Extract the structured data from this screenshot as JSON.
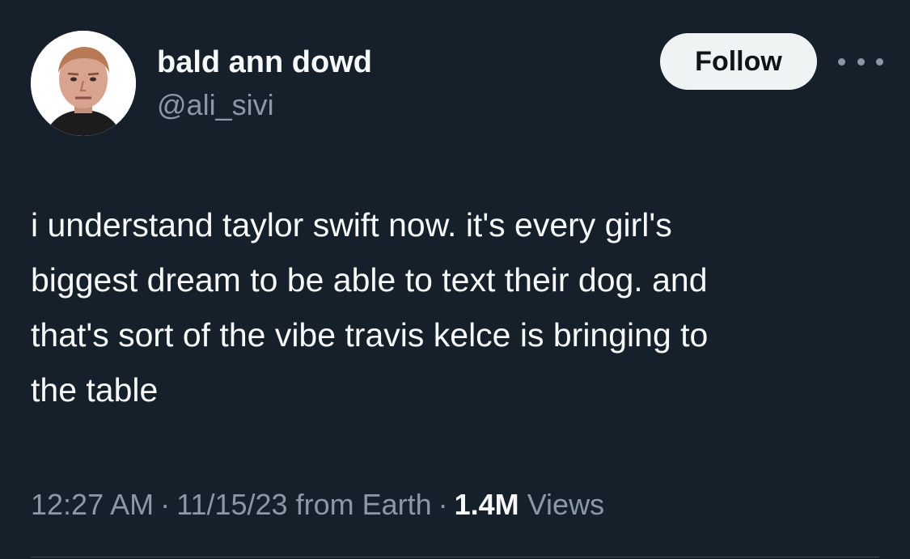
{
  "user": {
    "display_name": "bald ann dowd",
    "handle": "@ali_sivi"
  },
  "follow_button": {
    "label": "Follow"
  },
  "more_menu": {
    "icon": "more-horizontal-icon"
  },
  "tweet": {
    "lines": [
      "i understand taylor swift now. it's every girl's",
      "biggest dream to be able to text their dog. and",
      "that's sort of the vibe travis kelce is bringing to",
      "the table"
    ]
  },
  "meta": {
    "time": "12:27 AM",
    "separator": "·",
    "date_source": "11/15/23 from Earth",
    "views_count": "1.4M",
    "views_label": "Views"
  },
  "colors": {
    "background": "#15202b",
    "primary_text": "#f7f9f9",
    "secondary_text": "#8b98a5",
    "follow_bg": "#eff3f4"
  }
}
